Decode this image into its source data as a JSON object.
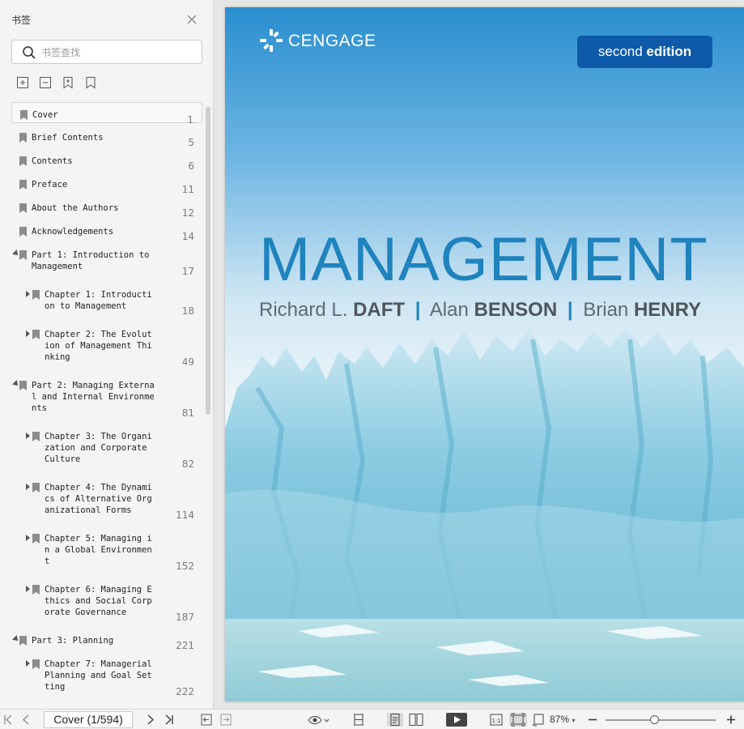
{
  "sidebar": {
    "title": "书签",
    "search_placeholder": "书签查找",
    "bookmarks": [
      {
        "title": "Cover",
        "page": "1",
        "level": 0,
        "expander": "none",
        "selected": true
      },
      {
        "title": "Brief Contents",
        "page": "5",
        "level": 0,
        "expander": "none"
      },
      {
        "title": "Contents",
        "page": "6",
        "level": 0,
        "expander": "none"
      },
      {
        "title": "Preface",
        "page": "11",
        "level": 0,
        "expander": "none"
      },
      {
        "title": "About the Authors",
        "page": "12",
        "level": 0,
        "expander": "none"
      },
      {
        "title": "Acknowledgements",
        "page": "14",
        "level": 0,
        "expander": "none"
      },
      {
        "title": "Part 1: Introduction to\nManagement",
        "page": "17",
        "level": 0,
        "expander": "expanded"
      },
      {
        "title": "Chapter 1: Introducti\non to Management",
        "page": "18",
        "level": 1,
        "expander": "collapsed"
      },
      {
        "title": "Chapter 2: The Evolut\nion of Management Thi\nnking",
        "page": "49",
        "level": 1,
        "expander": "collapsed"
      },
      {
        "title": "Part 2: Managing Externa\nl and Internal Environme\nnts",
        "page": "81",
        "level": 0,
        "expander": "expanded"
      },
      {
        "title": "Chapter 3: The Organi\nzation and Corporate\nCulture",
        "page": "82",
        "level": 1,
        "expander": "collapsed"
      },
      {
        "title": "Chapter 4: The Dynami\ncs of Alternative Org\nanizational Forms",
        "page": "114",
        "level": 1,
        "expander": "collapsed"
      },
      {
        "title": "Chapter 5: Managing i\nn a Global Environmen\nt",
        "page": "152",
        "level": 1,
        "expander": "collapsed"
      },
      {
        "title": "Chapter 6: Managing E\nthics and Social Corp\norate Governance",
        "page": "187",
        "level": 1,
        "expander": "collapsed"
      },
      {
        "title": "Part 3: Planning",
        "page": "221",
        "level": 0,
        "expander": "expanded"
      },
      {
        "title": "Chapter 7: Managerial\nPlanning and Goal Set\nting",
        "page": "222",
        "level": 1,
        "expander": "collapsed"
      }
    ]
  },
  "cover": {
    "publisher": "CENGAGE",
    "edition_prefix": "second",
    "edition_bold": "edition",
    "title": "MANAGEMENT",
    "authors": [
      {
        "first": "Richard L.",
        "last": "DAFT"
      },
      {
        "first": "Alan",
        "last": "BENSON"
      },
      {
        "first": "Brian",
        "last": "HENRY"
      }
    ],
    "author_separator": "|"
  },
  "statusbar": {
    "page_display": "Cover (1/594)",
    "zoom": "87%",
    "zoom_level": 0.45
  },
  "colors": {
    "title_blue": "#1f83bd",
    "edition_badge": "#0e5aa8",
    "sky_top": "#2a8fd0"
  }
}
